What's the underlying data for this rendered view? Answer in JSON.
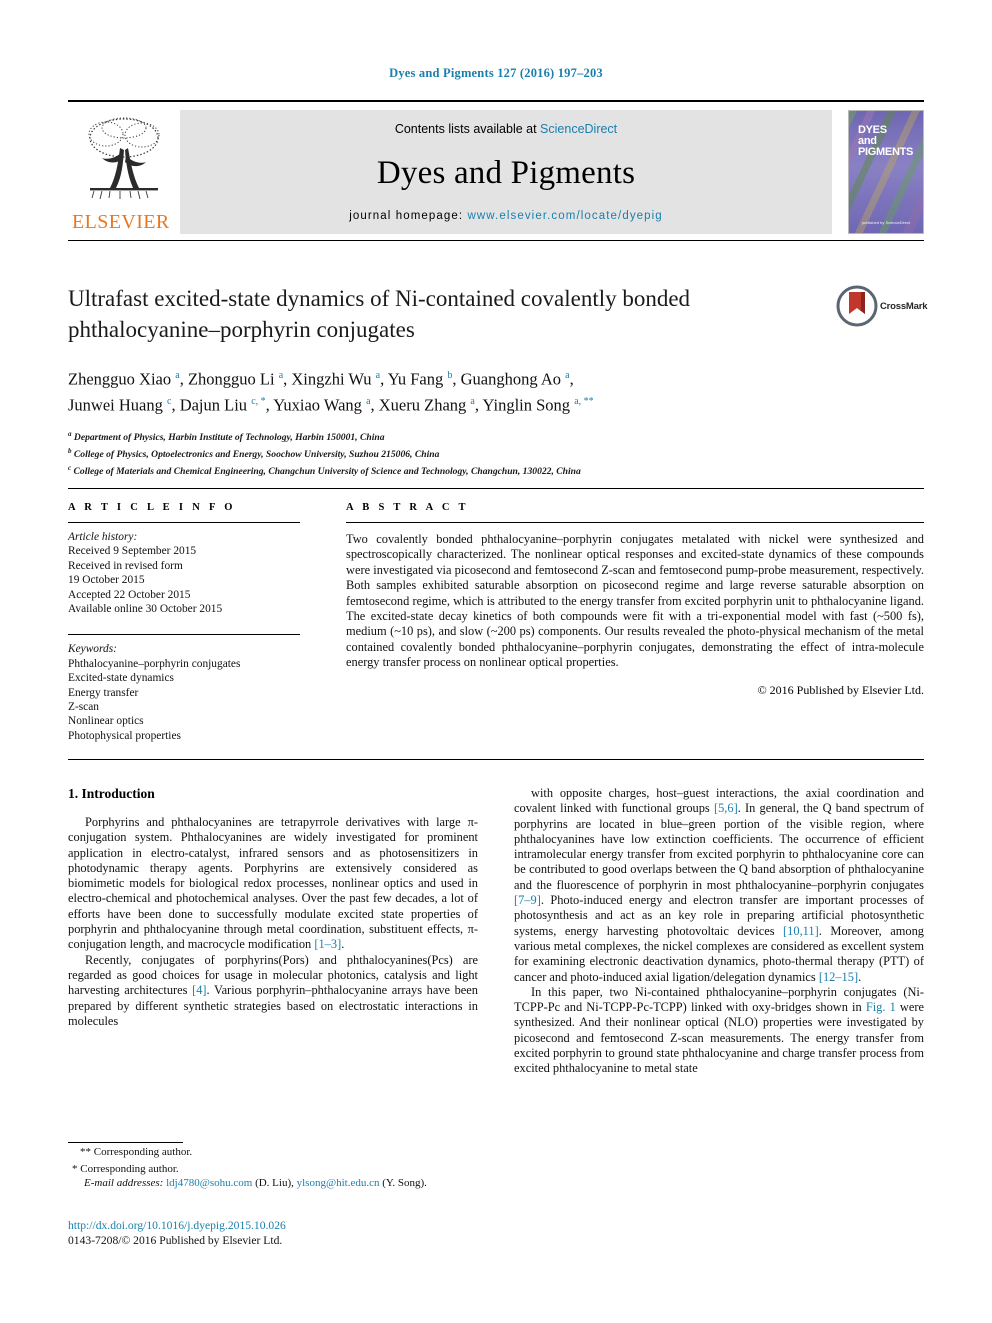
{
  "running_head": "Dyes and Pigments 127 (2016) 197–203",
  "header": {
    "contents_prefix": "Contents lists available at ",
    "sciencedirect": "ScienceDirect",
    "journal_name": "Dyes and Pigments",
    "homepage_prefix": "journal homepage: ",
    "homepage_url": "www.elsevier.com/locate/dyepig",
    "publisher_logo_text": "ELSEVIER",
    "cover_title_lines": [
      "DYES",
      "and",
      "PIGMENTS"
    ],
    "cover_footer": "published by ScienceDirect",
    "link_color": "#1a7fad",
    "panel_bg": "#e3e3e3",
    "elsevier_orange": "#E87722"
  },
  "article": {
    "title": "Ultrafast excited-state dynamics of Ni-contained covalently bonded phthalocyanine–porphyrin conjugates",
    "crossmark_label": "CrossMark",
    "authors_line1": "Zhengguo Xiao <sup>a</sup>, Zhongguo Li <sup>a</sup>, Xingzhi Wu <sup>a</sup>, Yu Fang <sup>b</sup>, Guanghong Ao <sup>a</sup>,",
    "authors_line2": "Junwei Huang <sup>c</sup>, Dajun Liu <sup>c, *</sup>, Yuxiao Wang <sup>a</sup>, Xueru Zhang <sup>a</sup>, Yinglin Song <sup>a, **</sup>",
    "affiliations": [
      "<sup>a</sup> Department of Physics, Harbin Institute of Technology, Harbin 150001, China",
      "<sup>b</sup> College of Physics, Optoelectronics and Energy, Soochow University, Suzhou 215006, China",
      "<sup>c</sup> College of Materials and Chemical Engineering, Changchun University of Science and Technology, Changchun, 130022, China"
    ]
  },
  "article_info": {
    "heading": "A R T I C L E   I N F O",
    "history_label": "Article history:",
    "history": [
      "Received 9 September 2015",
      "Received in revised form",
      "19 October 2015",
      "Accepted 22 October 2015",
      "Available online 30 October 2015"
    ],
    "keywords_label": "Keywords:",
    "keywords": [
      "Phthalocyanine–porphyrin conjugates",
      "Excited-state dynamics",
      "Energy transfer",
      "Z-scan",
      "Nonlinear optics",
      "Photophysical properties"
    ]
  },
  "abstract": {
    "heading": "A B S T R A C T",
    "text": "Two covalently bonded phthalocyanine–porphyrin conjugates metalated with nickel were synthesized and spectroscopically characterized. The nonlinear optical responses and excited-state dynamics of these compounds were investigated via picosecond and femtosecond Z-scan and femtosecond pump-probe measurement, respectively. Both samples exhibited saturable absorption on picosecond regime and large reverse saturable absorption on femtosecond regime, which is attributed to the energy transfer from excited porphyrin unit to phthalocyanine ligand. The excited-state decay kinetics of both compounds were fit with a tri-exponential model with fast (~500 fs), medium (~10 ps), and slow (~200 ps) components. Our results revealed the photo-physical mechanism of the metal contained covalently bonded phthalocyanine–porphyrin conjugates, demonstrating the effect of intra-molecule energy transfer process on nonlinear optical properties.",
    "copyright": "© 2016 Published by Elsevier Ltd."
  },
  "body": {
    "section_heading": "1.  Introduction",
    "left_paragraphs": [
      "Porphyrins and phthalocyanines are tetrapyrrole derivatives with large π-conjugation system. Phthalocyanines are widely investigated for prominent application in electro-catalyst, infrared sensors and as photosensitizers in photodynamic therapy agents. Porphyrins are extensively considered as biomimetic models for biological redox processes, nonlinear optics and used in electro-chemical and photochemical analyses. Over the past few decades, a lot of efforts have been done to successfully modulate excited state properties of porphyrin and phthalocyanine through metal coordination, substituent effects, π-conjugation length, and macrocycle modification [1–3].",
      "Recently, conjugates of porphyrins(Pors) and phthalocyanines(Pcs) are regarded as good choices for usage in molecular photonics, catalysis and light harvesting architectures [4]. Various porphyrin–phthalocyanine arrays have been prepared by different synthetic strategies based on electrostatic interactions in molecules"
    ],
    "right_paragraphs": [
      "with opposite charges, host–guest interactions, the axial coordination and covalent linked with functional groups [5,6]. In general, the Q band spectrum of porphyrins are located in blue–green portion of the visible region, where phthalocyanines have low extinction coefficients. The occurrence of efficient intramolecular energy transfer from excited porphyrin to phthalocyanine core can be contributed to good overlaps between the Q band absorption of phthalocyanine and the fluorescence of porphyrin in most phthalocyanine–porphyrin conjugates [7–9]. Photo-induced energy and electron transfer are important processes of photosynthesis and act as an key role in preparing artificial photosynthetic systems, energy harvesting photovoltaic devices [10,11]. Moreover, among various metal complexes, the nickel complexes are considered as excellent system for examining electronic deactivation dynamics, photo-thermal therapy (PTT) of cancer and photo-induced axial ligation/delegation dynamics [12–15].",
      "In this paper, two Ni-contained phthalocyanine–porphyrin conjugates (Ni-TCPP-Pc and Ni-TCPP-Pc-TCPP) linked with oxy-bridges shown in Fig. 1 were synthesized. And their nonlinear optical (NLO) properties were investigated by picosecond and femtosecond Z-scan measurements. The energy transfer from excited porphyrin to ground state phthalocyanine and charge transfer process from excited phthalocyanine to metal state"
    ]
  },
  "footnotes": {
    "corresponding_double": "** Corresponding author.",
    "corresponding_single": "* Corresponding author.",
    "email_label": "E-mail addresses:",
    "email_1": "ldj4780@sohu.com",
    "email_1_name": "(D. Liu),",
    "email_2": "ylsong@hit.edu.cn",
    "email_2_name": "(Y. Song)."
  },
  "footer": {
    "doi": "http://dx.doi.org/10.1016/j.dyepig.2015.10.026",
    "issn": "0143-7208/© 2016 Published by Elsevier Ltd."
  }
}
